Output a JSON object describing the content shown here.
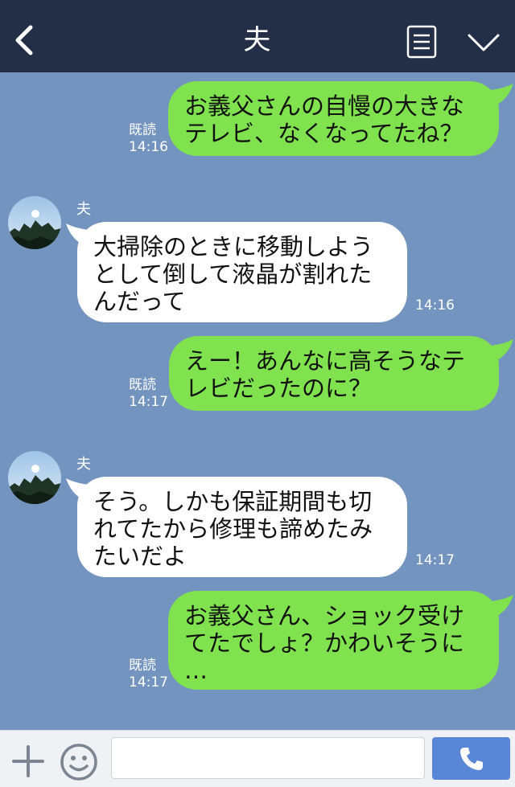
{
  "header": {
    "title": "夫"
  },
  "messages": [
    {
      "side": "me",
      "text": "お義父さんの自慢の大きな\nテレビ、なくなってたね？",
      "read": "既読",
      "time": "14:16"
    },
    {
      "side": "them",
      "sender": "夫",
      "text": "大掃除のときに移動しよう\nとして倒して液晶が割れた\nんだって",
      "time": "14:16"
    },
    {
      "side": "me",
      "text": "えー！あんなに高そうなテ\nレビだったのに？",
      "read": "既読",
      "time": "14:17"
    },
    {
      "side": "them",
      "sender": "夫",
      "text": "そう。しかも保証期間も切\nれてたから修理も諦めたみ\nたいだよ",
      "time": "14:17"
    },
    {
      "side": "me",
      "text": "お義父さん、ショック受け\nてたでしょ？かわいそうに\n…",
      "read": "既読",
      "time": "14:17"
    }
  ],
  "inputbar": {
    "placeholder": ""
  },
  "colors": {
    "header_bg": "#232f47",
    "chat_bg": "#7494c0",
    "my_bubble": "#7fe24e",
    "their_bubble": "#ffffff",
    "call_button": "#5a86d8"
  },
  "icons": [
    "back-chevron-icon",
    "menu-icon",
    "chevron-down-icon",
    "plus-icon",
    "emoji-icon",
    "phone-icon"
  ]
}
